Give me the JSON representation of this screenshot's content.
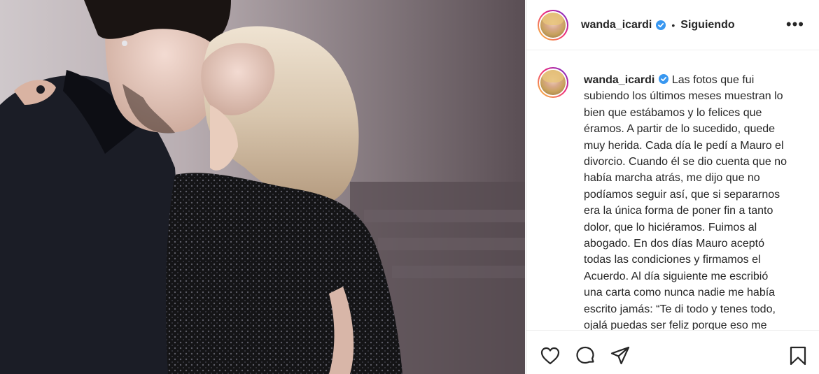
{
  "post": {
    "username": "wanda_icardi",
    "separator": "•",
    "follow_status": "Siguiendo",
    "more_label": "•••",
    "caption_lines": [
      "Las fotos que fui",
      "subiendo los últimos meses muestran lo",
      "bien que estábamos y lo felices que",
      "éramos. A partir de lo sucedido, quede",
      "muy herida. Cada día le pedí a Mauro el",
      "divorcio. Cuando él se dio cuenta que no",
      "había marcha atrás, me dijo que no",
      "podíamos seguir así, que si separarnos",
      "era la única forma de poner fin a tanto",
      "dolor, que lo hiciéramos. Fuimos al",
      "abogado. En dos días Mauro aceptó",
      "todas las condiciones y firmamos el",
      "Acuerdo. Al día siguiente me escribió",
      "una carta como nunca nadie me había",
      "escrito jamás: “Te di todo y tenes todo,",
      "ojalá puedas ser feliz porque eso me"
    ]
  },
  "icons": {
    "verified": "verified-badge-icon",
    "like": "heart-icon",
    "comment": "comment-icon",
    "share": "paper-plane-icon",
    "save": "bookmark-icon"
  },
  "colors": {
    "verified": "#3897f0",
    "text": "#262626",
    "border": "#dbdbdb"
  }
}
